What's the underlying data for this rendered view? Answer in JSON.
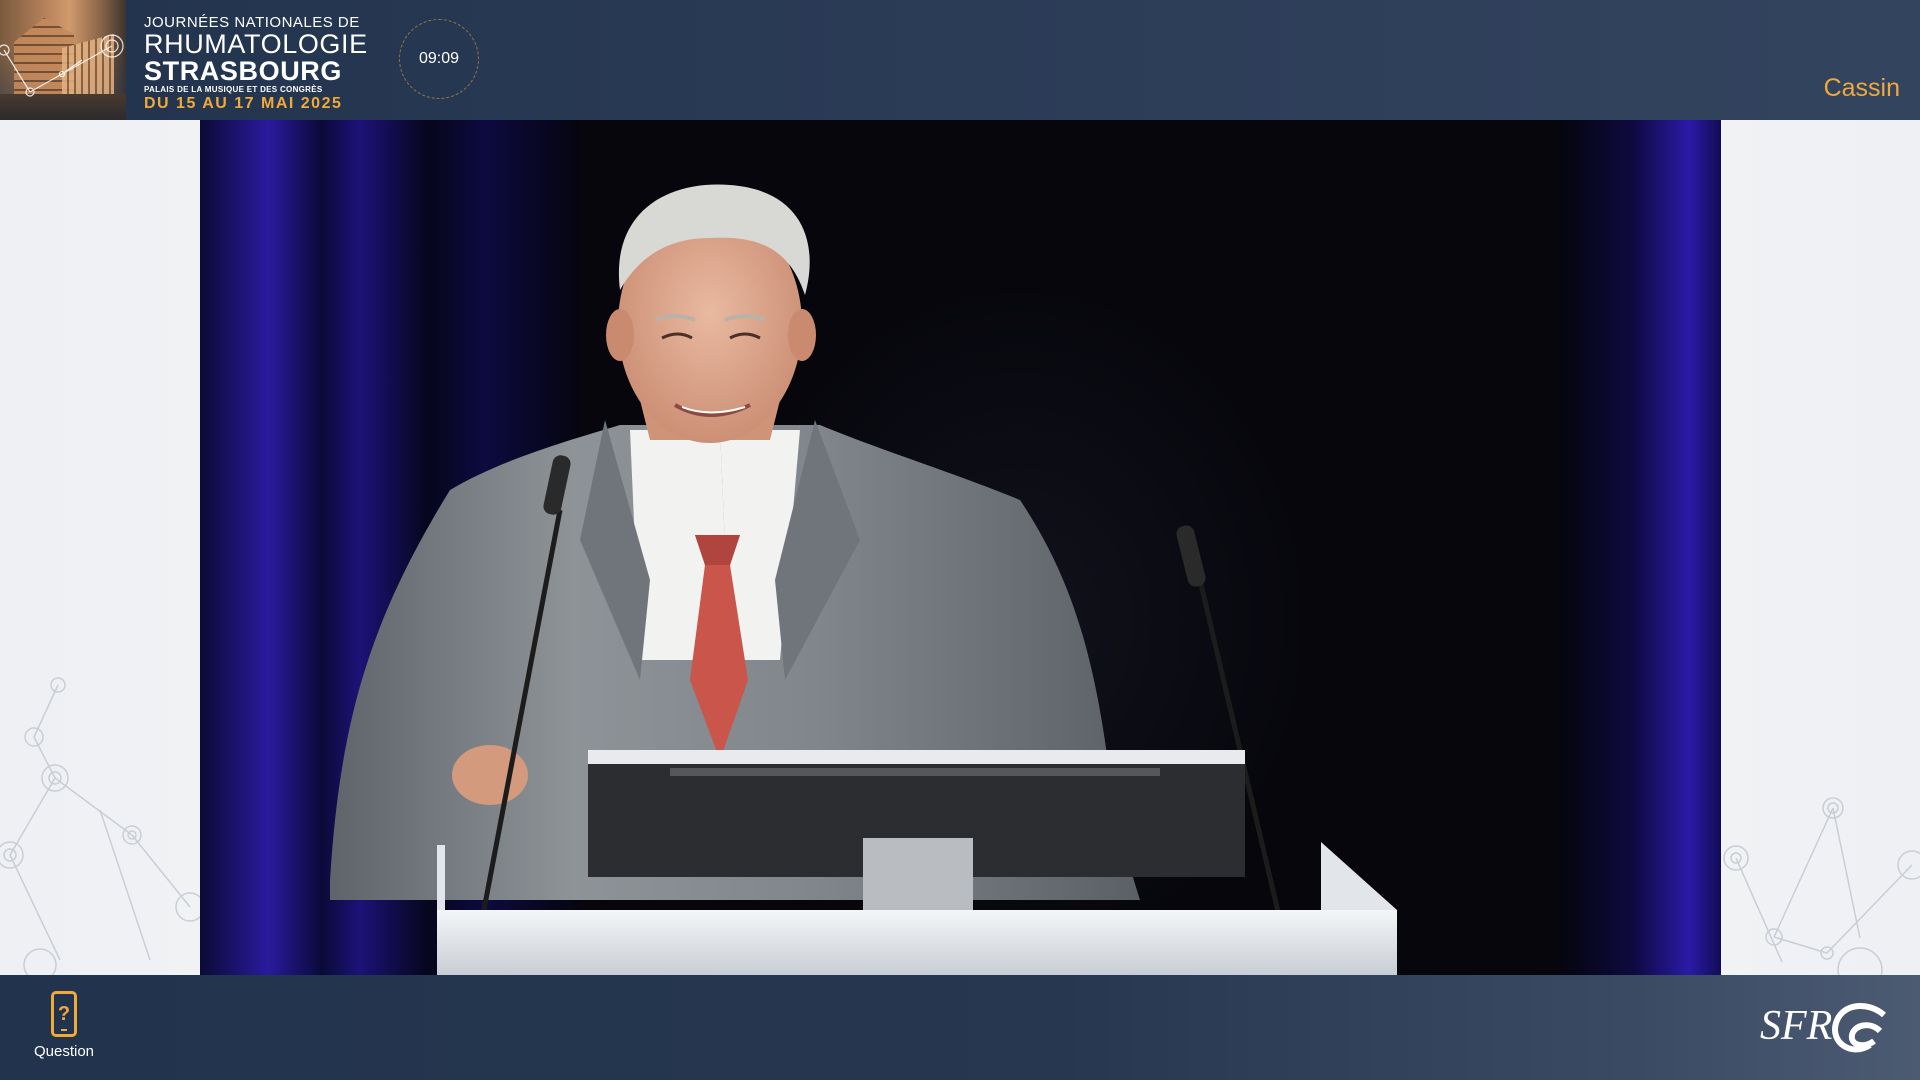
{
  "header": {
    "event_line1": "JOURNÉES NATIONALES DE",
    "event_line2": "RHUMATOLOGIE",
    "event_city": "STRASBOURG",
    "event_venue": "PALAIS DE LA MUSIQUE ET DES CONGRÈS",
    "event_dates": "DU 15 AU 17 MAI 2025",
    "clock": "09:09",
    "room": "Cassin"
  },
  "bottom_bar": {
    "question_label": "Question",
    "question_icon": "phone-question-icon",
    "logo_text": "SFR"
  },
  "colors": {
    "header_bg": "#22334d",
    "accent": "#f0a93b",
    "text": "#ffffff",
    "side_bg": "#f4f5f7"
  }
}
